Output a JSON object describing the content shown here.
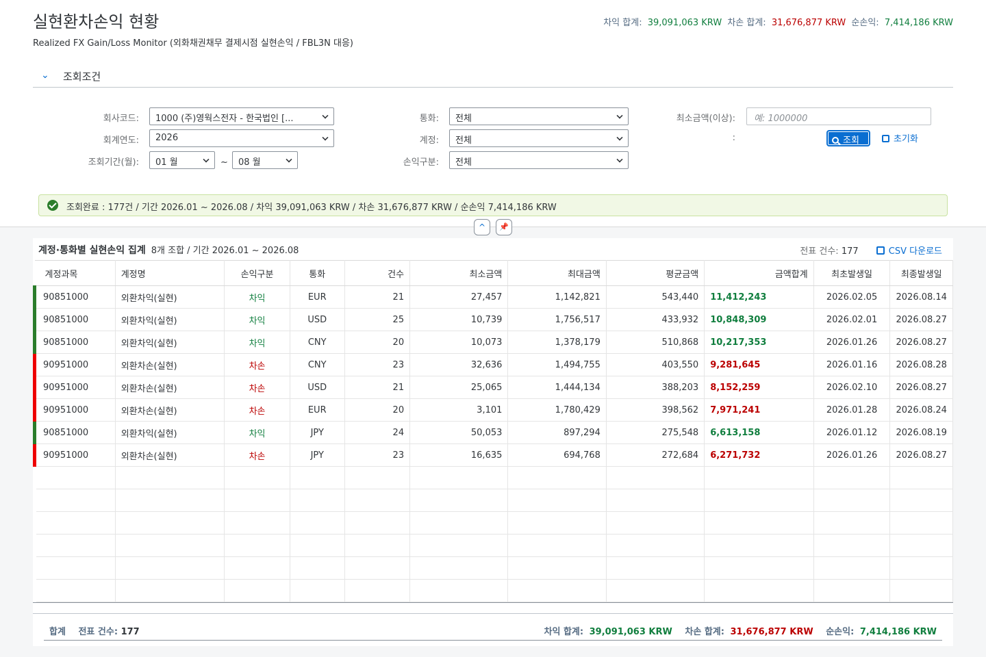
{
  "page": {
    "title": "실현환차손익 현황",
    "subtitle": "Realized FX Gain/Loss Monitor (외화채권채무 결제시점 실현손익 / FBL3N 대응)"
  },
  "kpi": {
    "gain_label": "차익 합계:",
    "gain_value": "39,091,063 KRW",
    "loss_label": "차손 합계:",
    "loss_value": "31,676,877 KRW",
    "net_label": "순손익:",
    "net_value": "7,414,186 KRW"
  },
  "filter": {
    "section_label": "조회조건",
    "company_label": "회사코드:",
    "company_value": "1000 (주)영웍스전자 - 한국법인 [...",
    "year_label": "회계연도:",
    "year_value": "2026",
    "period_label": "조회기간(월):",
    "period_from": "01 월",
    "period_sep": "~",
    "period_to": "08 월",
    "currency_label": "통화:",
    "currency_value": "전체",
    "account_label": "계정:",
    "account_value": "전체",
    "pl_type_label": "손익구분:",
    "pl_type_value": "전체",
    "min_amount_label": "최소금액(이상):",
    "min_amount_placeholder": "예: 1000000",
    "action_label": ":",
    "search_button": "조회",
    "reset_button": "초기화"
  },
  "message": {
    "text": "조회완료 : 177건 / 기간 2026.01 ~ 2026.08 / 차익 39,091,063 KRW / 차손 31,676,877 KRW / 순손익 7,414,186 KRW"
  },
  "toggles": {
    "collapse": "^",
    "pin": "📌"
  },
  "table": {
    "title": "계정·통화별 실현손익 집계",
    "subtitle": "8개 조합 / 기간 2026.01 ~ 2026.08",
    "doc_count_label": "전표 건수:",
    "doc_count": "177",
    "csv_button": "CSV 다운로드",
    "columns": [
      "계정과목",
      "계정명",
      "손익구분",
      "통화",
      "건수",
      "최소금액",
      "최대금액",
      "평균금액",
      "금액합계",
      "최초발생일",
      "최종발생일"
    ],
    "rows": [
      {
        "account": "90851000",
        "name": "외환차익(실현)",
        "type": "차익",
        "currency": "EUR",
        "count": "21",
        "min": "27,457",
        "max": "1,142,821",
        "avg": "543,440",
        "sum": "11,412,243",
        "first": "2026.02.05",
        "last": "2026.08.14",
        "kind": "gain"
      },
      {
        "account": "90851000",
        "name": "외환차익(실현)",
        "type": "차익",
        "currency": "USD",
        "count": "25",
        "min": "10,739",
        "max": "1,756,517",
        "avg": "433,932",
        "sum": "10,848,309",
        "first": "2026.02.01",
        "last": "2026.08.27",
        "kind": "gain"
      },
      {
        "account": "90851000",
        "name": "외환차익(실현)",
        "type": "차익",
        "currency": "CNY",
        "count": "20",
        "min": "10,073",
        "max": "1,378,179",
        "avg": "510,868",
        "sum": "10,217,353",
        "first": "2026.01.26",
        "last": "2026.08.27",
        "kind": "gain"
      },
      {
        "account": "90951000",
        "name": "외환차손(실현)",
        "type": "차손",
        "currency": "CNY",
        "count": "23",
        "min": "32,636",
        "max": "1,494,755",
        "avg": "403,550",
        "sum": "9,281,645",
        "first": "2026.01.16",
        "last": "2026.08.28",
        "kind": "loss"
      },
      {
        "account": "90951000",
        "name": "외환차손(실현)",
        "type": "차손",
        "currency": "USD",
        "count": "21",
        "min": "25,065",
        "max": "1,444,134",
        "avg": "388,203",
        "sum": "8,152,259",
        "first": "2026.02.10",
        "last": "2026.08.27",
        "kind": "loss"
      },
      {
        "account": "90951000",
        "name": "외환차손(실현)",
        "type": "차손",
        "currency": "EUR",
        "count": "20",
        "min": "3,101",
        "max": "1,780,429",
        "avg": "398,562",
        "sum": "7,971,241",
        "first": "2026.01.28",
        "last": "2026.08.24",
        "kind": "loss"
      },
      {
        "account": "90851000",
        "name": "외환차익(실현)",
        "type": "차익",
        "currency": "JPY",
        "count": "24",
        "min": "50,053",
        "max": "897,294",
        "avg": "275,548",
        "sum": "6,613,158",
        "first": "2026.01.12",
        "last": "2026.08.19",
        "kind": "gain"
      },
      {
        "account": "90951000",
        "name": "외환차손(실현)",
        "type": "차손",
        "currency": "JPY",
        "count": "23",
        "min": "16,635",
        "max": "694,768",
        "avg": "272,684",
        "sum": "6,271,732",
        "first": "2026.01.26",
        "last": "2026.08.27",
        "kind": "loss"
      }
    ]
  },
  "footer": {
    "total_label": "합계",
    "doc_count_label": "전표 건수:",
    "doc_count": "177",
    "gain_label": "차익 합계:",
    "gain_value": "39,091,063 KRW",
    "loss_label": "차손 합계:",
    "loss_value": "31,676,877 KRW",
    "net_label": "순손익:",
    "net_value": "7,414,186 KRW"
  },
  "colors": {
    "gain": "#107e3e",
    "loss": "#bb0000",
    "accent": "#0a6ed1"
  }
}
